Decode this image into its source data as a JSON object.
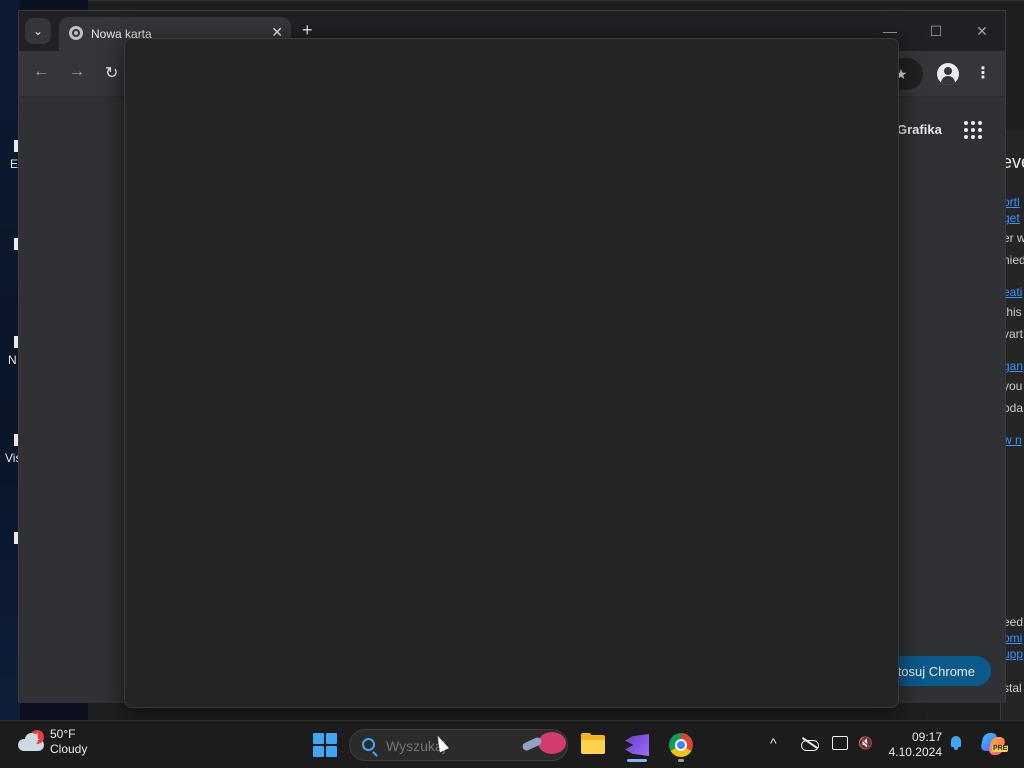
{
  "browser": {
    "tab_title": "Nowa karta",
    "tab_close": "✕",
    "new_tab": "+",
    "window_controls": {
      "minimize": "—",
      "maximize": "☐",
      "close": "✕"
    },
    "nav": {
      "back": "←",
      "forward": "→",
      "reload": "↻"
    },
    "bookmark_star": "★",
    "menu": "⋮",
    "grafika_link": "Grafika",
    "customize_button": "tosuj Chrome"
  },
  "background_window": {
    "title_fragment": "eve",
    "text_fragments": [
      {
        "text": "ortl",
        "link": true
      },
      {
        "text": "get",
        "link": true
      },
      {
        "text": "er w",
        "link": false
      },
      {
        "text": "nied",
        "link": false
      },
      {
        "text": "eati",
        "link": true
      },
      {
        "text": "this",
        "link": false
      },
      {
        "text": "vart",
        "link": false
      },
      {
        "text": "gan",
        "link": true
      },
      {
        "text": " you",
        "link": false
      },
      {
        "text": "oda,",
        "link": false
      },
      {
        "text": "w n",
        "link": true
      },
      {
        "text": "eed",
        "link": false
      },
      {
        "text": "omi",
        "link": true
      },
      {
        "text": "upp",
        "link": true
      },
      {
        "text": "stal",
        "link": false
      }
    ]
  },
  "desktop_fragments": [
    "E",
    "N",
    "Vis"
  ],
  "taskbar": {
    "weather_temp": "50°F",
    "weather_desc": "Cloudy",
    "weather_badge": "1",
    "search_placeholder": "Wyszukaj",
    "time": "09:17",
    "date": "4.10.2024",
    "tray_chevron": "^"
  },
  "colors": {
    "accent": "#3ea6f5",
    "customize_btn": "#0b5a8c",
    "chrome_bg": "#35363a"
  }
}
